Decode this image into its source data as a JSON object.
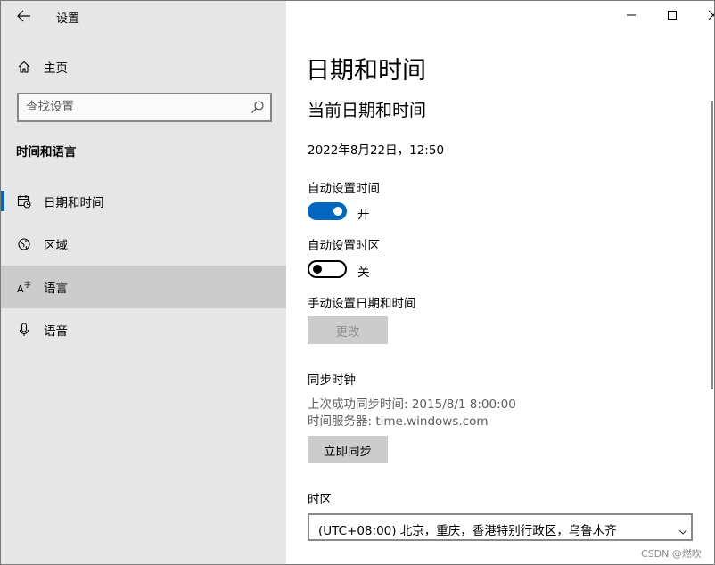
{
  "window": {
    "app_title": "设置",
    "back_icon": "back-arrow-icon",
    "controls": [
      "minimize-icon",
      "maximize-icon",
      "close-icon"
    ]
  },
  "sidebar": {
    "home_label": "主页",
    "search": {
      "placeholder": "查找设置",
      "icon": "search-icon"
    },
    "section_heading": "时间和语言",
    "items": [
      {
        "label": "日期和时间",
        "icon": "clock-calendar-icon",
        "selected": true
      },
      {
        "label": "区域",
        "icon": "globe-icon"
      },
      {
        "label": "语言",
        "icon": "language-icon",
        "hovered": true
      },
      {
        "label": "语音",
        "icon": "microphone-icon"
      }
    ]
  },
  "main": {
    "title": "日期和时间",
    "subtitle": "当前日期和时间",
    "current_datetime": "2022年8月22日，12:50",
    "auto_time": {
      "label": "自动设置时间",
      "state": "开",
      "on": true
    },
    "auto_timezone": {
      "label": "自动设置时区",
      "state": "关",
      "on": false
    },
    "manual": {
      "label": "手动设置日期和时间",
      "button": "更改"
    },
    "sync": {
      "heading": "同步时钟",
      "last_sync": "上次成功同步时间: 2015/8/1 8:00:00",
      "server": "时间服务器: time.windows.com",
      "button": "立即同步"
    },
    "timezone": {
      "label": "时区",
      "value": "(UTC+08:00) 北京，重庆，香港特别行政区，乌鲁木齐"
    }
  },
  "watermark": "CSDN @燃吹",
  "colors": {
    "accent": "#0067c0",
    "sidebar_bg": "#e6e6e6",
    "hover_bg": "#cccccc"
  }
}
